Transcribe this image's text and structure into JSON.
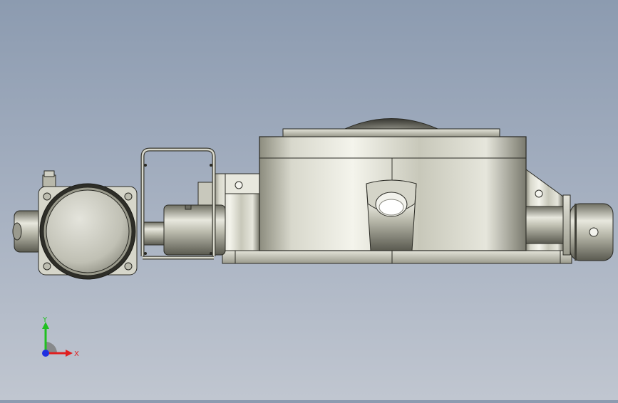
{
  "viewport": {
    "background_top": "#8c9bb0",
    "background_bottom": "#c0c6d0",
    "view": "front"
  },
  "model": {
    "name": "",
    "parts": [
      "motor-housing",
      "handle-frame",
      "shaft",
      "turntable-body",
      "dome-cap",
      "base-plate",
      "right-shaft-end",
      "bracket"
    ]
  },
  "triad": {
    "x_label": "X",
    "y_label": "Y",
    "x_color": "#e02020",
    "y_color": "#20c020",
    "z_color": "#2030e0"
  }
}
